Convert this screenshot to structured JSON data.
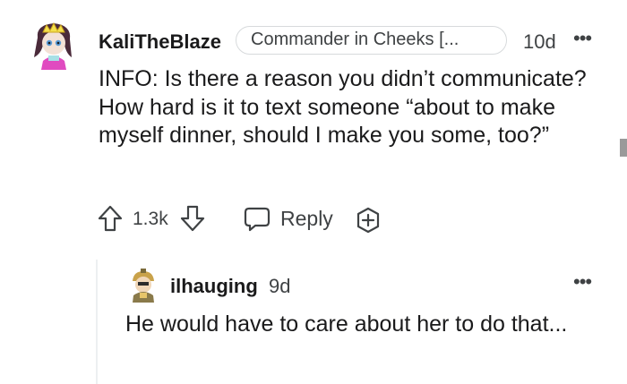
{
  "comment": {
    "author": "KaliTheBlaze",
    "flair": "Commander in Cheeks [...",
    "age": "10d",
    "more": "•••",
    "body": "INFO: Is there a reason you didn’t communicate? How hard is it to text someone “about to make myself dinner, should I make you some, too?”",
    "score": "1.3k",
    "reply_label": "Reply"
  },
  "reply": {
    "author": "ilhauging",
    "age": "9d",
    "more": "•••",
    "body": "He would have to care about her to do that..."
  },
  "colors": {
    "text": "#1a1a1b",
    "meta": "#3f4244",
    "border": "#d7dadc",
    "thread_line": "#edeff1"
  },
  "icons": [
    "avatar-kali",
    "upvote-icon",
    "downvote-icon",
    "reply-icon",
    "award-icon",
    "more-icon",
    "avatar-ilhauging"
  ]
}
